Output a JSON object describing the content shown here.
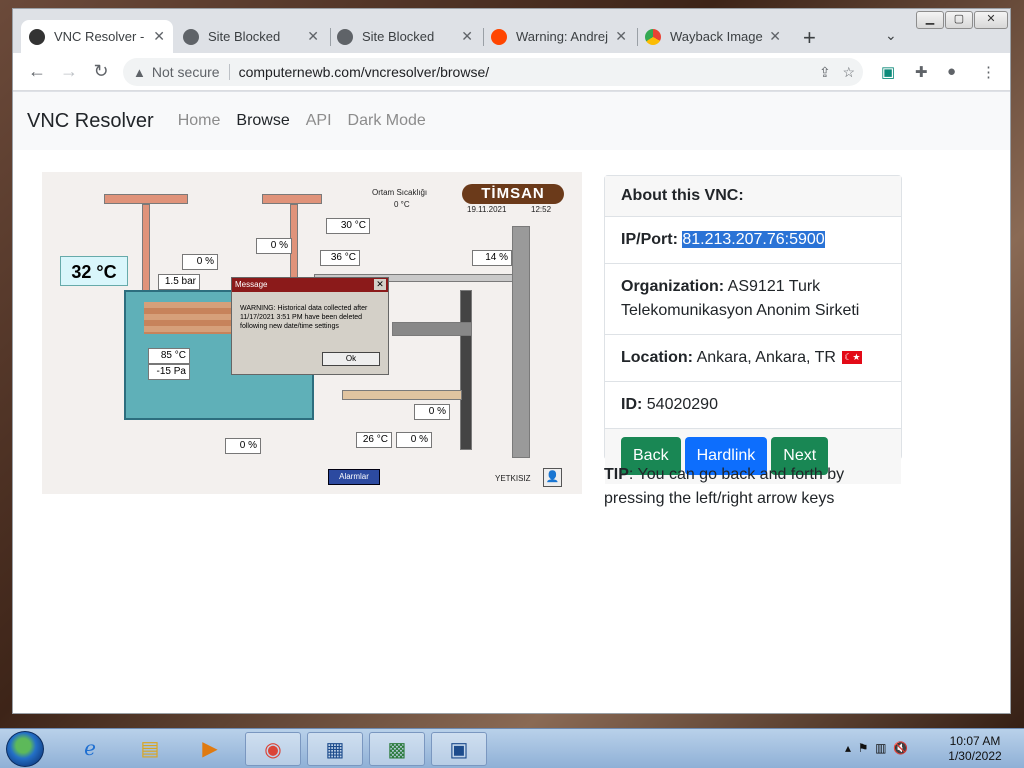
{
  "browser": {
    "tabs": [
      {
        "title": "VNC Resolver - Browse",
        "favicon": "ghost-icon",
        "color": "#333333"
      },
      {
        "title": "Site Blocked",
        "favicon": "globe-icon",
        "color": "#5f6368"
      },
      {
        "title": "Site Blocked",
        "favicon": "globe-icon",
        "color": "#5f6368"
      },
      {
        "title": "Warning: Andrej",
        "favicon": "reddit-icon",
        "color": "#ff4500"
      },
      {
        "title": "Wayback Images",
        "favicon": "chrome-icon",
        "color": "#fbbc04"
      }
    ],
    "not_secure": "Not secure",
    "url": "computernewb.com/vncresolver/browse/"
  },
  "site": {
    "brand": "VNC Resolver",
    "nav": [
      "Home",
      "Browse",
      "API",
      "Dark Mode"
    ]
  },
  "vnc_screen": {
    "logo": "TİMSAN",
    "date": "19.11.2021",
    "time": "12:52",
    "ambient_label": "Ortam Sıcaklığı",
    "ambient_value": "0 °C",
    "big_temp": "32 °C",
    "values": {
      "v_30": "30 °C",
      "v_0a": "0 %",
      "v_0b": "0 %",
      "v_36": "36 °C",
      "v_14": "14 %",
      "v_15": "1.5 bar",
      "v_85": "85 °C",
      "v_m15": "-15 Pa",
      "v_0c": "0 %",
      "v_0d": "0 %",
      "v_26": "26 °C",
      "v_0e": "0 %"
    },
    "dialog_title": "Message",
    "dialog_text": "WARNING: Historical data collected after 11/17/2021 3:51 PM have been deleted following new date/time settings",
    "dialog_ok": "Ok",
    "alarm_button": "Alarmlar",
    "user_label": "YETKISIZ"
  },
  "info": {
    "header": "About this VNC:",
    "ip_label": "IP/Port:",
    "ip_value": "81.213.207.76:5900",
    "org_label": "Organization:",
    "org_value": "AS9121 Turk Telekomunikasyon Anonim Sirketi",
    "loc_label": "Location:",
    "loc_value": "Ankara, Ankara, TR",
    "id_label": "ID:",
    "id_value": "54020290",
    "buttons": {
      "back": "Back",
      "hardlink": "Hardlink",
      "next": "Next"
    },
    "tip_label": "TIP",
    "tip_text": ": You can go back and forth by pressing the left/right arrow keys"
  },
  "taskbar": {
    "time": "10:07 AM",
    "date": "1/30/2022"
  }
}
